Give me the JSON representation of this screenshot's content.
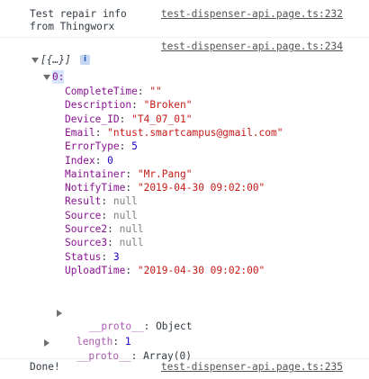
{
  "console": {
    "msg1": {
      "text_line1": "Test repair info",
      "text_line2": "from Thingworx",
      "source": "test-dispenser-api.page.ts:232"
    },
    "msg2": {
      "source": "test-dispenser-api.page.ts:234",
      "array_preview": "[{…}]",
      "info_icon": "i",
      "index_label": "0:",
      "properties": [
        {
          "key": "CompleteTime",
          "value": "\"\"",
          "type": "str"
        },
        {
          "key": "Description",
          "value": "\"Broken\"",
          "type": "str"
        },
        {
          "key": "Device_ID",
          "value": "\"T4_07_01\"",
          "type": "str"
        },
        {
          "key": "Email",
          "value": "\"ntust.smartcampus@gmail.com\"",
          "type": "str"
        },
        {
          "key": "ErrorType",
          "value": "5",
          "type": "num"
        },
        {
          "key": "Index",
          "value": "0",
          "type": "num"
        },
        {
          "key": "Maintainer",
          "value": "\"Mr.Pang\"",
          "type": "str"
        },
        {
          "key": "NotifyTime",
          "value": "\"2019-04-30 09:02:00\"",
          "type": "str"
        },
        {
          "key": "Result",
          "value": "null",
          "type": "nul"
        },
        {
          "key": "Source",
          "value": "null",
          "type": "nul"
        },
        {
          "key": "Source2",
          "value": "null",
          "type": "nul"
        },
        {
          "key": "Source3",
          "value": "null",
          "type": "nul"
        },
        {
          "key": "Status",
          "value": "3",
          "type": "num"
        },
        {
          "key": "UploadTime",
          "value": "\"2019-04-30 09:02:00\"",
          "type": "str"
        }
      ],
      "proto_inner_key": "__proto__",
      "proto_inner_value": "Object",
      "length_key": "length",
      "length_value": "1",
      "proto_outer_key": "__proto__",
      "proto_outer_value": "Array(0)"
    },
    "msg3": {
      "text": "Done!",
      "source": "test-dispenser-api.page.ts:235"
    }
  }
}
